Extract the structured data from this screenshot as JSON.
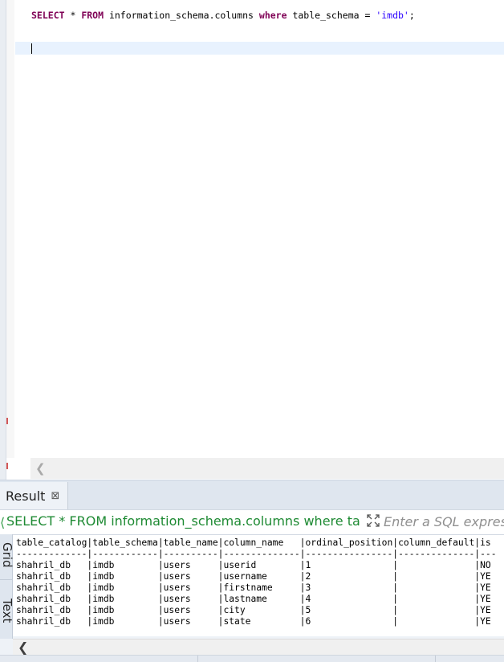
{
  "editor": {
    "sql_tokens": [
      {
        "text": "SELECT",
        "kind": "kw"
      },
      {
        "text": " * ",
        "kind": "op"
      },
      {
        "text": "FROM",
        "kind": "kw"
      },
      {
        "text": " information_schema.columns ",
        "kind": "op"
      },
      {
        "text": "where",
        "kind": "kw"
      },
      {
        "text": " table_schema = ",
        "kind": "op"
      },
      {
        "text": "'imdb'",
        "kind": "str"
      },
      {
        "text": ";",
        "kind": "op"
      }
    ]
  },
  "result_panel": {
    "tab_label": "Result",
    "close_glyph": "⊠",
    "query_preview": "SELECT * FROM information_schema.columns where tab",
    "filter_placeholder": "Enter a SQL expression",
    "side_tabs": {
      "grid": "Grid",
      "text": "Text"
    }
  },
  "result_text": {
    "columns": [
      {
        "name": "table_catalog",
        "width": 13
      },
      {
        "name": "table_schema",
        "width": 12
      },
      {
        "name": "table_name",
        "width": 10
      },
      {
        "name": "column_name",
        "width": 14
      },
      {
        "name": "ordinal_position",
        "width": 16
      },
      {
        "name": "column_default",
        "width": 14
      },
      {
        "name": "is",
        "width": 3
      }
    ],
    "rows": [
      [
        "shahril_db",
        "imdb",
        "users",
        "userid",
        "1",
        "",
        "NO"
      ],
      [
        "shahril_db",
        "imdb",
        "users",
        "username",
        "2",
        "",
        "YE"
      ],
      [
        "shahril_db",
        "imdb",
        "users",
        "firstname",
        "3",
        "",
        "YE"
      ],
      [
        "shahril_db",
        "imdb",
        "users",
        "lastname",
        "4",
        "",
        "YE"
      ],
      [
        "shahril_db",
        "imdb",
        "users",
        "city",
        "5",
        "",
        "YE"
      ],
      [
        "shahril_db",
        "imdb",
        "users",
        "state",
        "6",
        "",
        "YE"
      ]
    ]
  },
  "colors": {
    "keyword": "#7f0055",
    "string": "#2a00ff",
    "query_green": "#1e8a33",
    "current_line": "#e8f2fe"
  }
}
